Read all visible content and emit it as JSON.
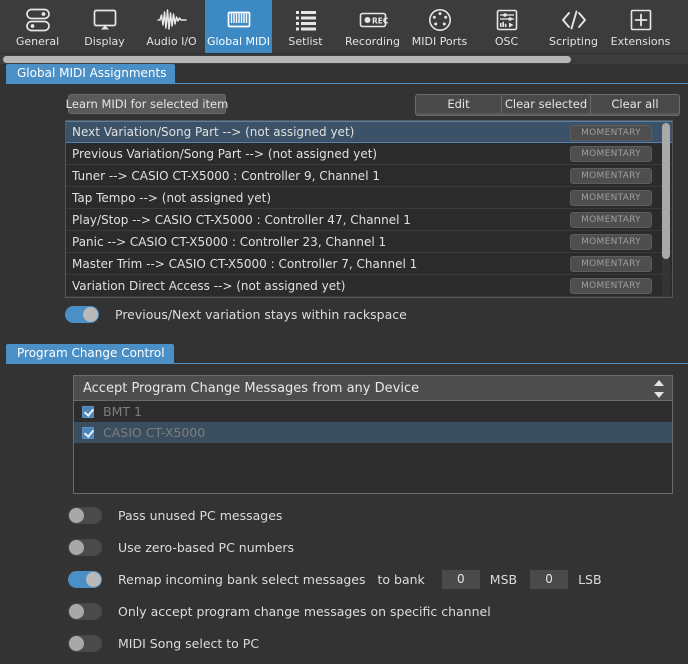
{
  "toolbar": {
    "items": [
      {
        "label": "General",
        "icon": "general-icon",
        "active": false
      },
      {
        "label": "Display",
        "icon": "display-icon",
        "active": false
      },
      {
        "label": "Audio I/O",
        "icon": "waveform-icon",
        "active": false
      },
      {
        "label": "Global MIDI",
        "icon": "keyboard-icon",
        "active": true
      },
      {
        "label": "Setlist",
        "icon": "list-icon",
        "active": false
      },
      {
        "label": "Recording",
        "icon": "record-icon",
        "active": false
      },
      {
        "label": "MIDI Ports",
        "icon": "midi-din-icon",
        "active": false
      },
      {
        "label": "OSC",
        "icon": "osc-icon",
        "active": false
      },
      {
        "label": "Scripting",
        "icon": "code-icon",
        "active": false
      },
      {
        "label": "Extensions",
        "icon": "plus-box-icon",
        "active": false
      }
    ]
  },
  "global_midi": {
    "group_title": "Global MIDI Assignments",
    "learn_button": "Learn MIDI for selected item",
    "actions": [
      "Edit",
      "Clear selected",
      "Clear all"
    ],
    "badge_label": "MOMENTARY",
    "rows": [
      {
        "text": "Next Variation/Song Part --> (not assigned yet)",
        "selected": true
      },
      {
        "text": "Previous Variation/Song Part --> (not assigned yet)",
        "selected": false
      },
      {
        "text": "Tuner --> CASIO CT-X5000 : Controller 9, Channel 1",
        "selected": false
      },
      {
        "text": "Tap Tempo --> (not assigned yet)",
        "selected": false
      },
      {
        "text": "Play/Stop --> CASIO CT-X5000 : Controller 47, Channel 1",
        "selected": false
      },
      {
        "text": "Panic --> CASIO CT-X5000 : Controller 23, Channel 1",
        "selected": false
      },
      {
        "text": "Master Trim --> CASIO CT-X5000 : Controller 7, Channel 1",
        "selected": false
      },
      {
        "text": "Variation Direct Access --> (not assigned yet)",
        "selected": false
      }
    ],
    "stays_within_rackspace": {
      "label": "Previous/Next variation stays within rackspace",
      "on": true
    }
  },
  "program_change": {
    "group_title": "Program Change Control",
    "combo_value": "Accept Program Change Messages from any Device",
    "devices": [
      {
        "label": "BMT 1",
        "checked": true,
        "selected": false
      },
      {
        "label": "CASIO CT-X5000",
        "checked": true,
        "selected": true
      }
    ],
    "options": [
      {
        "label": "Pass unused PC messages",
        "on": false
      },
      {
        "label": "Use zero-based PC numbers",
        "on": false
      },
      {
        "label": "Only accept program change messages on specific channel",
        "on": false
      },
      {
        "label": "MIDI Song select to PC",
        "on": false
      }
    ],
    "remap": {
      "label": "Remap incoming bank select messages",
      "to_bank_label": "to bank",
      "on": true,
      "msb_value": "0",
      "msb_label": "MSB",
      "lsb_value": "0",
      "lsb_label": "LSB"
    }
  },
  "colors": {
    "accent": "#4a8fc6",
    "background": "#333333",
    "toolbar": "#3c3c3c",
    "selection": "#3b5268"
  }
}
